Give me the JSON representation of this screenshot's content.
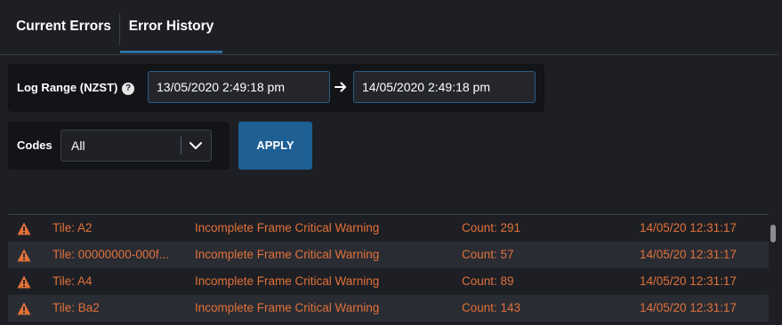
{
  "tabs": [
    {
      "label": "Current Errors",
      "active": false
    },
    {
      "label": "Error History",
      "active": true
    }
  ],
  "filters": {
    "log_range_label": "Log Range (NZST)",
    "help_glyph": "?",
    "start": "13/05/2020 2:49:18 pm",
    "end": "14/05/2020 2:49:18 pm",
    "codes_label": "Codes",
    "codes_value": "All",
    "apply_label": "APPLY"
  },
  "errors": [
    {
      "tile": "Tile: A2",
      "message": "Incomplete Frame Critical Warning",
      "count": "Count: 291",
      "time": "14/05/20 12:31:17"
    },
    {
      "tile": "Tile: 00000000-000f...",
      "message": "Incomplete Frame Critical Warning",
      "count": "Count: 57",
      "time": "14/05/20 12:31:17"
    },
    {
      "tile": "Tile: A4",
      "message": "Incomplete Frame Critical Warning",
      "count": "Count: 89",
      "time": "14/05/20 12:31:17"
    },
    {
      "tile": "Tile: Ba2",
      "message": "Incomplete Frame Critical Warning",
      "count": "Count: 143",
      "time": "14/05/20 12:31:17"
    }
  ],
  "colors": {
    "accent": "#2f6ea0",
    "error_text": "#e0713a",
    "apply_bg": "#1e5f94"
  },
  "icons": {
    "help": "help-icon",
    "arrow": "arrow-right-icon",
    "dropdown": "chevron-down-icon",
    "warning": "warning-icon"
  }
}
